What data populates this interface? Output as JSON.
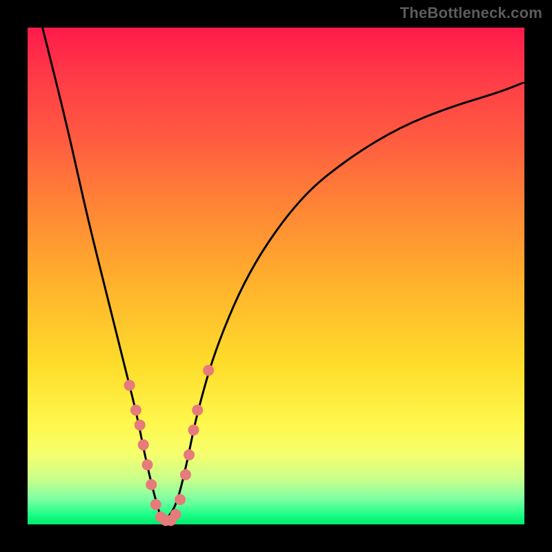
{
  "watermark": "TheBottleneck.com",
  "chart_data": {
    "type": "line",
    "title": "",
    "xlabel": "",
    "ylabel": "",
    "xlim": [
      0,
      100
    ],
    "ylim": [
      0,
      100
    ],
    "grid": false,
    "legend": false,
    "series": [
      {
        "name": "bottleneck-curve",
        "x": [
          3,
          8,
          12,
          16,
          20,
          22,
          24,
          26,
          27,
          28,
          30,
          32,
          34,
          38,
          45,
          55,
          65,
          75,
          85,
          95,
          100
        ],
        "y": [
          100,
          80,
          62,
          46,
          30,
          22,
          12,
          4,
          1,
          1,
          4,
          12,
          22,
          36,
          52,
          66,
          74,
          80,
          84,
          87,
          89
        ]
      }
    ],
    "markers": {
      "name": "highlight-points",
      "color": "#e77a7a",
      "radius": 8,
      "points": [
        {
          "x": 20.5,
          "y": 28
        },
        {
          "x": 21.8,
          "y": 23
        },
        {
          "x": 22.6,
          "y": 20
        },
        {
          "x": 23.3,
          "y": 16
        },
        {
          "x": 24.1,
          "y": 12
        },
        {
          "x": 24.9,
          "y": 8
        },
        {
          "x": 25.8,
          "y": 4
        },
        {
          "x": 26.8,
          "y": 1.5
        },
        {
          "x": 27.8,
          "y": 0.8
        },
        {
          "x": 28.8,
          "y": 0.8
        },
        {
          "x": 29.8,
          "y": 2
        },
        {
          "x": 30.7,
          "y": 5
        },
        {
          "x": 31.8,
          "y": 10
        },
        {
          "x": 32.5,
          "y": 14
        },
        {
          "x": 33.4,
          "y": 19
        },
        {
          "x": 34.2,
          "y": 23
        },
        {
          "x": 36.4,
          "y": 31
        }
      ]
    },
    "background": {
      "type": "vertical-gradient",
      "stops": [
        {
          "pos": 0,
          "color": "#ff1a4b"
        },
        {
          "pos": 52,
          "color": "#ffb32c"
        },
        {
          "pos": 80,
          "color": "#fff84e"
        },
        {
          "pos": 100,
          "color": "#00e86b"
        }
      ]
    }
  }
}
